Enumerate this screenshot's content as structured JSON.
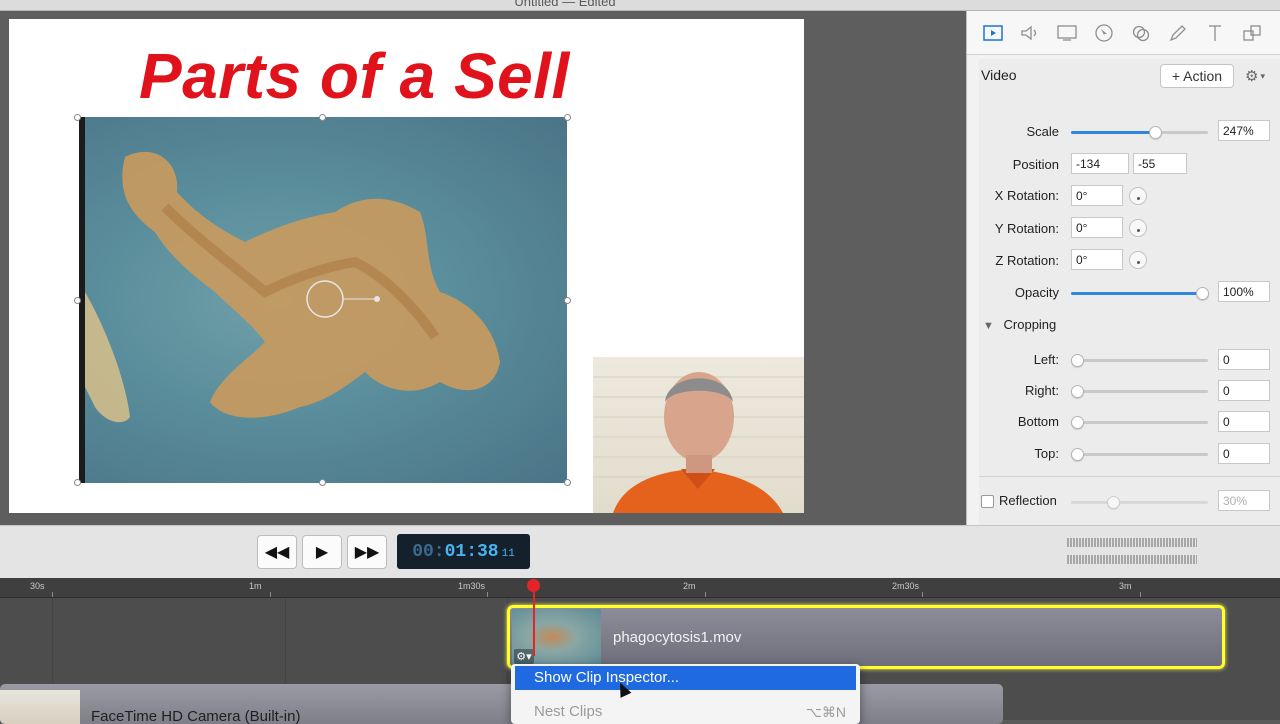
{
  "window": {
    "title": "Untitled — Edited"
  },
  "canvas": {
    "slide_title": "Parts of a Sell",
    "video_clip": "amoeba microscope video",
    "webcam_overlay": "presenter webcam"
  },
  "inspector": {
    "tabs": [
      "video-icon",
      "audio-icon",
      "screen-icon",
      "cursor-icon",
      "callout-icon",
      "annotation-icon",
      "text-icon",
      "build-icon"
    ],
    "section": "Video",
    "action_label": "+ Action",
    "scale": {
      "label": "Scale",
      "value": "247%",
      "fraction": 0.62
    },
    "position": {
      "label": "Position",
      "x": "-134",
      "y": "-55"
    },
    "x_rotation": {
      "label": "X Rotation:",
      "value": "0°"
    },
    "y_rotation": {
      "label": "Y Rotation:",
      "value": "0°"
    },
    "z_rotation": {
      "label": "Z Rotation:",
      "value": "0°"
    },
    "opacity": {
      "label": "Opacity",
      "value": "100%",
      "fraction": 1.0
    },
    "cropping": {
      "label": "Cropping",
      "left": {
        "label": "Left:",
        "value": "0"
      },
      "right": {
        "label": "Right:",
        "value": "0"
      },
      "bottom": {
        "label": "Bottom",
        "value": "0"
      },
      "top": {
        "label": "Top:",
        "value": "0"
      }
    },
    "reflection": {
      "label": "Reflection",
      "value": "30%",
      "checked": false
    }
  },
  "transport": {
    "timecode_dim": "00:",
    "timecode": "01:38",
    "frames": "11"
  },
  "timeline": {
    "ruler": [
      "30s",
      "1m",
      "1m30s",
      "2m",
      "2m30s",
      "3m"
    ],
    "clip1_name": "phagocytosis1.mov",
    "clip2_name": "FaceTime HD Camera (Built-in)"
  },
  "context_menu": {
    "items": [
      {
        "label": "Show Clip Inspector...",
        "shortcut": "",
        "state": "highlighted"
      },
      {
        "label": "Nest Clips",
        "shortcut": "⌥⌘N",
        "state": "disabled"
      }
    ]
  }
}
